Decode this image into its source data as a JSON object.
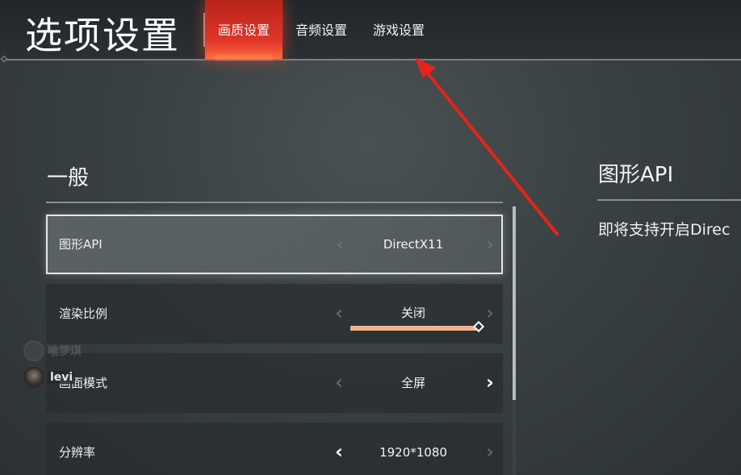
{
  "header": {
    "title": "选项设置",
    "tabs": [
      {
        "label": "画质设置",
        "active": true
      },
      {
        "label": "音频设置",
        "active": false
      },
      {
        "label": "游戏设置",
        "active": false
      }
    ]
  },
  "section": {
    "title": "一般",
    "rows": [
      {
        "label": "图形API",
        "value": "DirectX11",
        "selected": true,
        "prev_enabled": false,
        "next_enabled": false
      },
      {
        "label": "渲染比例",
        "value": "关闭",
        "slider_fraction": 1.0,
        "prev_enabled": false,
        "next_enabled": false
      },
      {
        "label": "画面模式",
        "value": "全屏",
        "prev_enabled": false,
        "next_enabled": true
      },
      {
        "label": "分辨率",
        "value": "1920*1080",
        "prev_enabled": true,
        "next_enabled": false
      }
    ]
  },
  "info_panel": {
    "title": "图形API",
    "text": "即将支持开启Direc"
  },
  "overlay_users": [
    {
      "name": "喻梦琪",
      "faded": true
    },
    {
      "name": "levi",
      "faded": false
    }
  ],
  "icons": {
    "prev": "chevron-left-icon",
    "next": "chevron-right-icon",
    "slider_handle": "diamond-handle-icon"
  },
  "colors": {
    "accent_tab": "#e0362a",
    "slider_fill": "#f0b48a",
    "annotation_arrow": "#e8231a"
  }
}
